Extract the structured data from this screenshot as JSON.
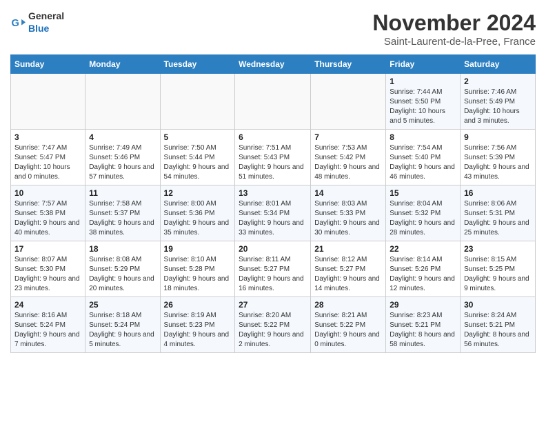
{
  "header": {
    "logo_general": "General",
    "logo_blue": "Blue",
    "month": "November 2024",
    "location": "Saint-Laurent-de-la-Pree, France"
  },
  "weekdays": [
    "Sunday",
    "Monday",
    "Tuesday",
    "Wednesday",
    "Thursday",
    "Friday",
    "Saturday"
  ],
  "weeks": [
    [
      {
        "day": "",
        "info": ""
      },
      {
        "day": "",
        "info": ""
      },
      {
        "day": "",
        "info": ""
      },
      {
        "day": "",
        "info": ""
      },
      {
        "day": "",
        "info": ""
      },
      {
        "day": "1",
        "info": "Sunrise: 7:44 AM\nSunset: 5:50 PM\nDaylight: 10 hours and 5 minutes."
      },
      {
        "day": "2",
        "info": "Sunrise: 7:46 AM\nSunset: 5:49 PM\nDaylight: 10 hours and 3 minutes."
      }
    ],
    [
      {
        "day": "3",
        "info": "Sunrise: 7:47 AM\nSunset: 5:47 PM\nDaylight: 10 hours and 0 minutes."
      },
      {
        "day": "4",
        "info": "Sunrise: 7:49 AM\nSunset: 5:46 PM\nDaylight: 9 hours and 57 minutes."
      },
      {
        "day": "5",
        "info": "Sunrise: 7:50 AM\nSunset: 5:44 PM\nDaylight: 9 hours and 54 minutes."
      },
      {
        "day": "6",
        "info": "Sunrise: 7:51 AM\nSunset: 5:43 PM\nDaylight: 9 hours and 51 minutes."
      },
      {
        "day": "7",
        "info": "Sunrise: 7:53 AM\nSunset: 5:42 PM\nDaylight: 9 hours and 48 minutes."
      },
      {
        "day": "8",
        "info": "Sunrise: 7:54 AM\nSunset: 5:40 PM\nDaylight: 9 hours and 46 minutes."
      },
      {
        "day": "9",
        "info": "Sunrise: 7:56 AM\nSunset: 5:39 PM\nDaylight: 9 hours and 43 minutes."
      }
    ],
    [
      {
        "day": "10",
        "info": "Sunrise: 7:57 AM\nSunset: 5:38 PM\nDaylight: 9 hours and 40 minutes."
      },
      {
        "day": "11",
        "info": "Sunrise: 7:58 AM\nSunset: 5:37 PM\nDaylight: 9 hours and 38 minutes."
      },
      {
        "day": "12",
        "info": "Sunrise: 8:00 AM\nSunset: 5:36 PM\nDaylight: 9 hours and 35 minutes."
      },
      {
        "day": "13",
        "info": "Sunrise: 8:01 AM\nSunset: 5:34 PM\nDaylight: 9 hours and 33 minutes."
      },
      {
        "day": "14",
        "info": "Sunrise: 8:03 AM\nSunset: 5:33 PM\nDaylight: 9 hours and 30 minutes."
      },
      {
        "day": "15",
        "info": "Sunrise: 8:04 AM\nSunset: 5:32 PM\nDaylight: 9 hours and 28 minutes."
      },
      {
        "day": "16",
        "info": "Sunrise: 8:06 AM\nSunset: 5:31 PM\nDaylight: 9 hours and 25 minutes."
      }
    ],
    [
      {
        "day": "17",
        "info": "Sunrise: 8:07 AM\nSunset: 5:30 PM\nDaylight: 9 hours and 23 minutes."
      },
      {
        "day": "18",
        "info": "Sunrise: 8:08 AM\nSunset: 5:29 PM\nDaylight: 9 hours and 20 minutes."
      },
      {
        "day": "19",
        "info": "Sunrise: 8:10 AM\nSunset: 5:28 PM\nDaylight: 9 hours and 18 minutes."
      },
      {
        "day": "20",
        "info": "Sunrise: 8:11 AM\nSunset: 5:27 PM\nDaylight: 9 hours and 16 minutes."
      },
      {
        "day": "21",
        "info": "Sunrise: 8:12 AM\nSunset: 5:27 PM\nDaylight: 9 hours and 14 minutes."
      },
      {
        "day": "22",
        "info": "Sunrise: 8:14 AM\nSunset: 5:26 PM\nDaylight: 9 hours and 12 minutes."
      },
      {
        "day": "23",
        "info": "Sunrise: 8:15 AM\nSunset: 5:25 PM\nDaylight: 9 hours and 9 minutes."
      }
    ],
    [
      {
        "day": "24",
        "info": "Sunrise: 8:16 AM\nSunset: 5:24 PM\nDaylight: 9 hours and 7 minutes."
      },
      {
        "day": "25",
        "info": "Sunrise: 8:18 AM\nSunset: 5:24 PM\nDaylight: 9 hours and 5 minutes."
      },
      {
        "day": "26",
        "info": "Sunrise: 8:19 AM\nSunset: 5:23 PM\nDaylight: 9 hours and 4 minutes."
      },
      {
        "day": "27",
        "info": "Sunrise: 8:20 AM\nSunset: 5:22 PM\nDaylight: 9 hours and 2 minutes."
      },
      {
        "day": "28",
        "info": "Sunrise: 8:21 AM\nSunset: 5:22 PM\nDaylight: 9 hours and 0 minutes."
      },
      {
        "day": "29",
        "info": "Sunrise: 8:23 AM\nSunset: 5:21 PM\nDaylight: 8 hours and 58 minutes."
      },
      {
        "day": "30",
        "info": "Sunrise: 8:24 AM\nSunset: 5:21 PM\nDaylight: 8 hours and 56 minutes."
      }
    ]
  ]
}
